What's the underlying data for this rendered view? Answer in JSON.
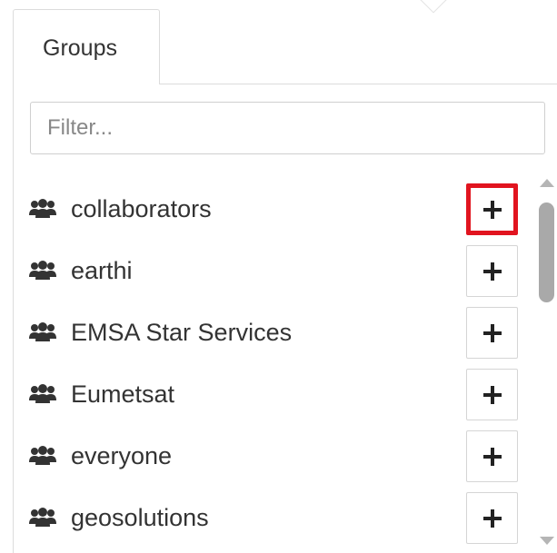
{
  "tabs": [
    {
      "label": "Groups",
      "active": true
    }
  ],
  "filter": {
    "placeholder": "Filter...",
    "value": ""
  },
  "groups": [
    {
      "name": "collaborators",
      "icon": "users-icon",
      "action": "add-icon",
      "highlighted": true
    },
    {
      "name": "earthi",
      "icon": "users-icon",
      "action": "add-icon",
      "highlighted": false
    },
    {
      "name": "EMSA Star Services",
      "icon": "users-icon",
      "action": "add-icon",
      "highlighted": false
    },
    {
      "name": "Eumetsat",
      "icon": "users-icon",
      "action": "add-icon",
      "highlighted": false
    },
    {
      "name": "everyone",
      "icon": "users-icon",
      "action": "add-icon",
      "highlighted": false
    },
    {
      "name": "geosolutions",
      "icon": "users-icon",
      "action": "add-icon",
      "highlighted": false
    }
  ],
  "colors": {
    "highlight": "#e1141f",
    "border": "#dcdcdc",
    "text": "#333333"
  }
}
